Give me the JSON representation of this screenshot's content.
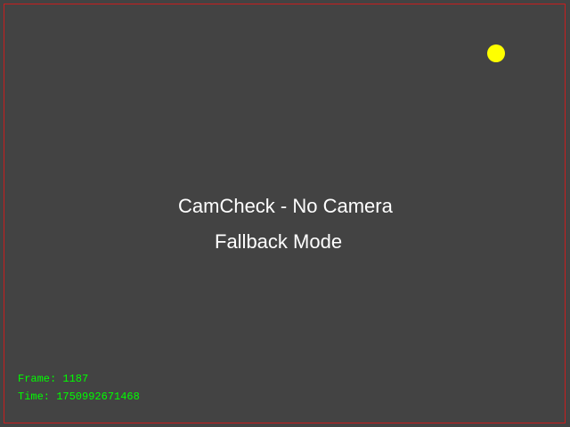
{
  "overlay": {
    "title": "CamCheck - No Camera",
    "subtitle": "Fallback Mode",
    "frame_text": "Frame: 1187",
    "time_text": "Time: 1750992671468"
  },
  "colors": {
    "background": "#434343",
    "border": "#c81e1e",
    "indicator": "#ffff00",
    "text": "#ffffff",
    "info_text": "#00ff00"
  }
}
